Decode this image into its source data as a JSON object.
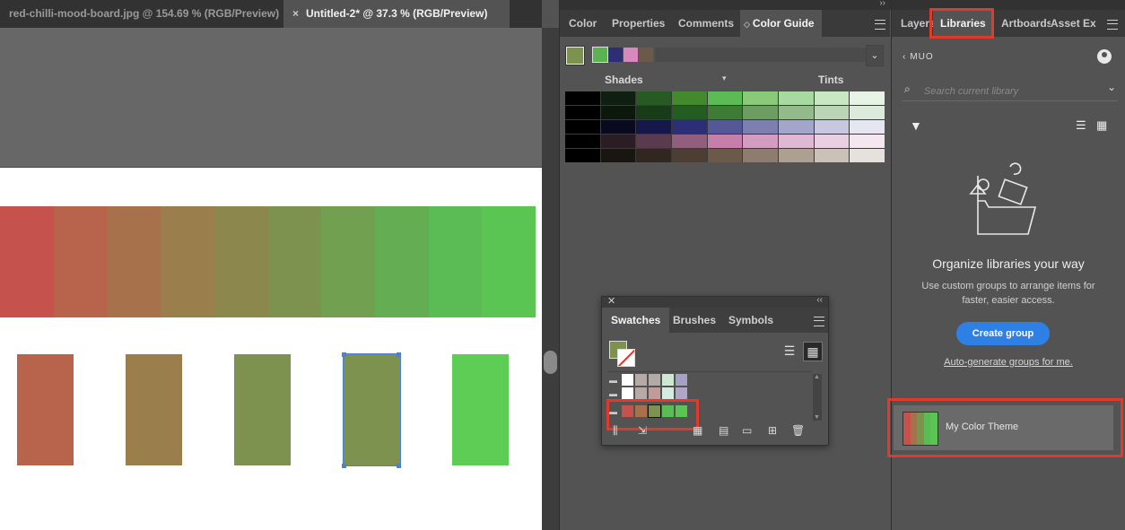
{
  "documents": {
    "tabs": [
      {
        "label": "red-chilli-mood-board.jpg @ 154.69 % (RGB/Preview)",
        "active": false
      },
      {
        "label": "Untitled-2* @ 37.3 % (RGB/Preview)",
        "active": true
      }
    ],
    "close_glyph": "×"
  },
  "canvas": {
    "gradient_colors": [
      "#c6524d",
      "#b8634c",
      "#a7724b",
      "#9a7e4b",
      "#8c884d",
      "#7e924f",
      "#71a050",
      "#64ad52",
      "#5bbb55",
      "#5ac553"
    ],
    "swatch_colors": [
      "#b8634c",
      "#9a7e4b",
      "#7e924f",
      "#7e924f",
      "#5ecd55"
    ]
  },
  "color_panel": {
    "tabs": [
      {
        "label": "Color",
        "active": false
      },
      {
        "label": "Properties",
        "active": false
      },
      {
        "label": "Comments",
        "active": false
      },
      {
        "label": "Color Guide",
        "active": true
      }
    ],
    "harmony_base": "#7e924f",
    "harmony_colors": [
      "#5ab34f",
      "#2d2e75",
      "#d888be",
      "#6b5a4a"
    ],
    "shades_label": "Shades",
    "tints_label": "Tints",
    "grid": [
      [
        "#000000",
        "#102010",
        "#285a24",
        "#43892e",
        "#5bbb55",
        "#88c97a",
        "#a8d9a0",
        "#c8e8c4",
        "#e7f4e5"
      ],
      [
        "#000000",
        "#0c180c",
        "#183b18",
        "#235d22",
        "#3e7c35",
        "#6e9d63",
        "#94b98b",
        "#bad4b5",
        "#dceadb"
      ],
      [
        "#000000",
        "#090a20",
        "#17184a",
        "#2c2e76",
        "#555897",
        "#7d7fb1",
        "#a3a5c9",
        "#c7c8df",
        "#e6e6f0"
      ],
      [
        "#000000",
        "#2a1d24",
        "#5a3a4e",
        "#925e7e",
        "#c67faa",
        "#d29dc0",
        "#dfb9d3",
        "#eacfe2",
        "#f4e7f0"
      ],
      [
        "#000000",
        "#191511",
        "#302720",
        "#4c3e33",
        "#6b5a4a",
        "#8d7d70",
        "#aca092",
        "#cac1b8",
        "#e5e1dc"
      ]
    ]
  },
  "swatches_panel": {
    "tabs": [
      {
        "label": "Swatches",
        "active": true
      },
      {
        "label": "Brushes",
        "active": false
      },
      {
        "label": "Symbols",
        "active": false
      }
    ],
    "fill_color": "#7e924f",
    "rows": [
      {
        "colors": [
          "#ffffff",
          "#b5aba4",
          "#b3aaa7",
          "#cce8d0",
          "#a3a1c4"
        ]
      },
      {
        "colors": [
          "#ffffff",
          "#b7aaa5",
          "#c09b97",
          "#d4ece0",
          "#b0a6c8"
        ]
      },
      {
        "colors": [
          "#c6524d",
          "#a7724b",
          "#7e924f",
          "#5bbb55",
          "#5ac553"
        ]
      }
    ]
  },
  "libraries_panel": {
    "tabs": [
      {
        "label": "Layers",
        "active": false
      },
      {
        "label": "Libraries",
        "active": true
      },
      {
        "label": "Artboards",
        "active": false
      },
      {
        "label": "Asset Ex",
        "active": false
      }
    ],
    "breadcrumb": "MUO",
    "search_placeholder": "Search current library",
    "organize_title": "Organize libraries your way",
    "organize_desc": "Use custom groups to arrange items for faster, easier access.",
    "create_group_label": "Create group",
    "auto_generate_label": "Auto-generate groups for me.",
    "theme_item_label": "My Color Theme",
    "theme_colors": [
      "#c6524d",
      "#a7724b",
      "#7e924f",
      "#5bbb55",
      "#5ac553"
    ]
  }
}
